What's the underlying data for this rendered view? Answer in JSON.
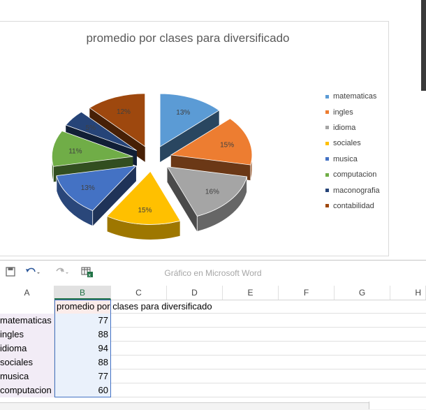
{
  "chart_data": {
    "type": "pie",
    "title": "promedio por clases para diversificado",
    "categories": [
      "matematicas",
      "ingles",
      "idioma",
      "sociales",
      "musica",
      "computacion",
      "maconografia",
      "contabilidad"
    ],
    "values": [
      13,
      15,
      16,
      15,
      13,
      11,
      5,
      12
    ],
    "labels": [
      "13%",
      "15%",
      "16%",
      "15%",
      "13%",
      "11%",
      "5%",
      "12%"
    ],
    "colors": [
      "#5b9bd5",
      "#ed7d31",
      "#a5a5a5",
      "#ffc000",
      "#4472c4",
      "#70ad47",
      "#264478",
      "#9e480e"
    ],
    "legend_position": "right",
    "style": "3d-exploded"
  },
  "toolbar": {
    "save_icon": "save-icon",
    "undo_icon": "undo-icon",
    "redo_icon": "redo-icon",
    "chart_icon": "excel-chart-icon",
    "window_title": "Gráfico en Microsoft Word"
  },
  "sheet": {
    "columns": [
      "A",
      "B",
      "C",
      "D",
      "E",
      "F",
      "G",
      "H"
    ],
    "header_b": "promedio por clases para diversificado",
    "rows": [
      {
        "a": "matematicas",
        "b": "77"
      },
      {
        "a": "ingles",
        "b": "88"
      },
      {
        "a": "idioma",
        "b": "94"
      },
      {
        "a": "sociales",
        "b": "88"
      },
      {
        "a": "musica",
        "b": "77"
      },
      {
        "a": "computacion",
        "b": "60"
      }
    ]
  }
}
